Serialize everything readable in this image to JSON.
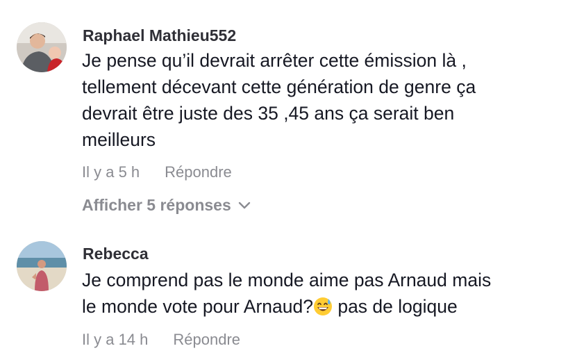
{
  "comments": [
    {
      "username": "Raphael Mathieu552",
      "text_lines": [
        "Je pense qu’il devrait arrêter cette émission là ,",
        "tellement décevant cette génération de genre ça",
        "devrait être juste des 35 ,45 ans ça serait ben",
        "meilleurs"
      ],
      "time": "Il y a 5 h",
      "reply_label": "Répondre",
      "view_replies_label": "Afficher 5 réponses"
    },
    {
      "username": "Rebecca",
      "text_line1": "Je comprend pas le monde aime pas Arnaud mais",
      "text_line2_before_emoji": "le monde vote pour Arnaud?",
      "text_line2_after_emoji": " pas de logique",
      "emoji": "grinning-sweat-emoji",
      "time": "Il y a 14 h",
      "reply_label": "Répondre"
    }
  ],
  "colors": {
    "primary_text": "#161823",
    "username": "#2f2f36",
    "secondary_text": "#8a8b91"
  }
}
